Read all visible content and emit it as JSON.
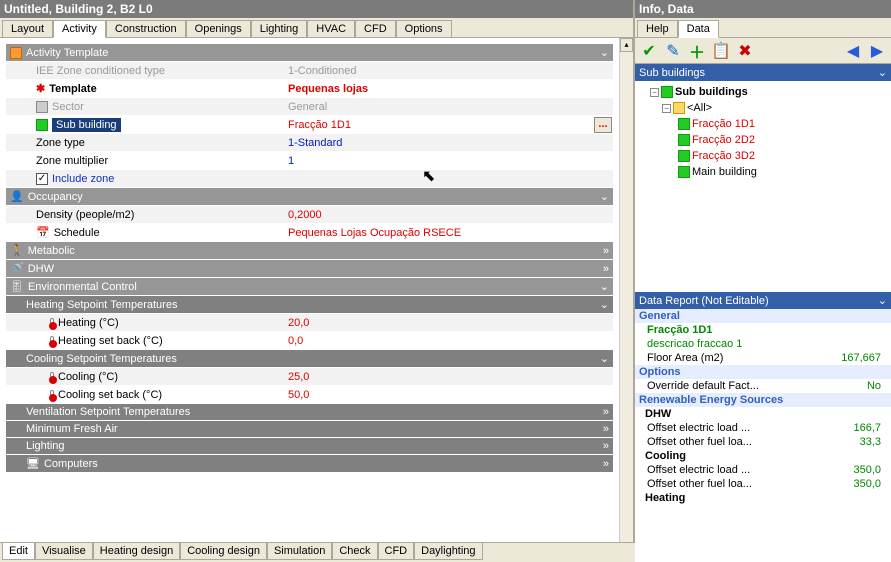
{
  "left_title": "Untitled, Building 2, B2 L0",
  "right_title": "Info, Data",
  "tabs": [
    "Layout",
    "Activity",
    "Construction",
    "Openings",
    "Lighting",
    "HVAC",
    "CFD",
    "Options"
  ],
  "active_tab": "Activity",
  "right_tabs": [
    "Help",
    "Data"
  ],
  "right_active_tab": "Data",
  "bottom_tabs": [
    "Edit",
    "Visualise",
    "Heating design",
    "Cooling design",
    "Simulation",
    "Check",
    "CFD",
    "Daylighting"
  ],
  "bottom_active": "Edit",
  "sections": {
    "activity_template": "Activity Template",
    "occupancy": "Occupancy",
    "metabolic": "Metabolic",
    "dhw": "DHW",
    "env_control": "Environmental Control",
    "heating_sp": "Heating Setpoint Temperatures",
    "cooling_sp": "Cooling Setpoint Temperatures",
    "vent_sp": "Ventilation Setpoint Temperatures",
    "min_fresh": "Minimum Fresh Air",
    "lighting": "Lighting",
    "computers": "Computers"
  },
  "rows": {
    "iee": {
      "label": "IEE Zone conditioned type",
      "value": "1-Conditioned"
    },
    "template": {
      "label": "Template",
      "value": "Pequenas lojas"
    },
    "sector": {
      "label": "Sector",
      "value": "General"
    },
    "subbuild": {
      "label": "Sub building",
      "value": "Fracção 1D1"
    },
    "zonetype": {
      "label": "Zone type",
      "value": "1-Standard"
    },
    "zonemult": {
      "label": "Zone multiplier",
      "value": "1"
    },
    "include": {
      "label": "Include zone"
    },
    "density": {
      "label": "Density (people/m2)",
      "value": "0,2000"
    },
    "schedule": {
      "label": "Schedule",
      "value": "Pequenas Lojas Ocupação RSECE"
    },
    "heating": {
      "label": "Heating (°C)",
      "value": "20,0"
    },
    "heating_sb": {
      "label": "Heating set back (°C)",
      "value": "0,0"
    },
    "cooling": {
      "label": "Cooling (°C)",
      "value": "25,0"
    },
    "cooling_sb": {
      "label": "Cooling set back (°C)",
      "value": "50,0"
    }
  },
  "right_panel_title": "Sub buildings",
  "tree": {
    "root": "Sub buildings",
    "all": "<All>",
    "items": [
      {
        "label": "Fracção 1D1",
        "red": true
      },
      {
        "label": "Fracção 2D2",
        "red": true
      },
      {
        "label": "Fracção 3D2",
        "red": true
      },
      {
        "label": "Main building",
        "red": false
      }
    ]
  },
  "report_title": "Data Report (Not Editable)",
  "report": {
    "general": "General",
    "name": "Fracção 1D1",
    "desc": "descricao fraccao 1",
    "floor_area_lbl": "Floor Area (m2)",
    "floor_area_val": "167,667",
    "options": "Options",
    "override_lbl": "Override default Fact...",
    "override_val": "No",
    "renew": "Renewable Energy Sources",
    "dhw": "DHW",
    "offset_elec_lbl": "Offset electric load ...",
    "offset_elec_val": "166,7",
    "offset_other_lbl": "Offset other fuel loa...",
    "offset_other_val": "33,3",
    "cooling": "Cooling",
    "c_offset_elec_val": "350,0",
    "c_offset_other_val": "350,0",
    "heating": "Heating"
  }
}
